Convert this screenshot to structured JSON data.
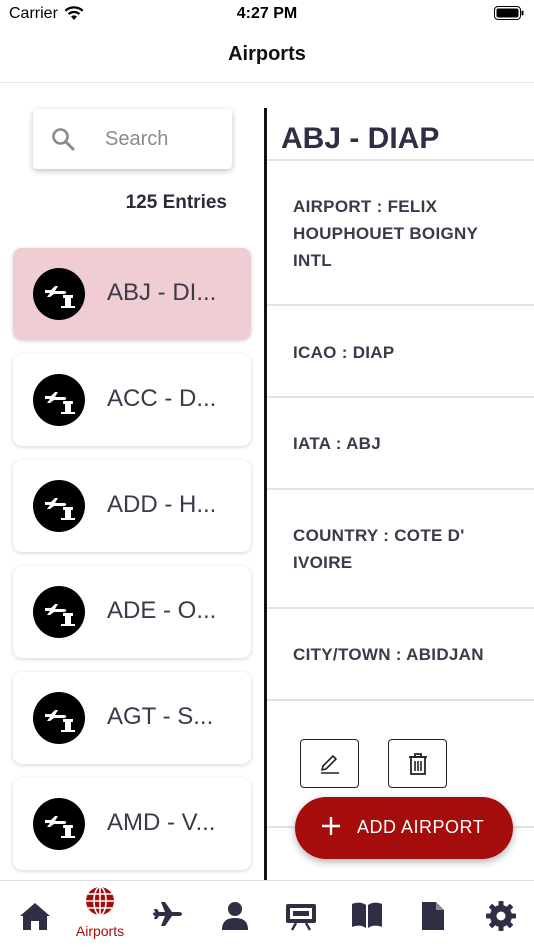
{
  "status_bar": {
    "carrier": "Carrier",
    "time": "4:27 PM"
  },
  "header": {
    "title": "Airports"
  },
  "search": {
    "placeholder": "Search"
  },
  "entries_count": "125 Entries",
  "airports": [
    {
      "label": "ABJ - DI...",
      "selected": true
    },
    {
      "label": "ACC - D..."
    },
    {
      "label": "ADD - H..."
    },
    {
      "label": "ADE - O..."
    },
    {
      "label": "AGT - S..."
    },
    {
      "label": "AMD - V..."
    }
  ],
  "detail": {
    "title": "ABJ - DIAP",
    "airport": "AIRPORT : FELIX HOUPHOUET BOIGNY INTL",
    "icao": "ICAO : DIAP",
    "iata": "IATA : ABJ",
    "country": "COUNTRY : COTE D' IVOIRE",
    "city": "CITY/TOWN : ABIDJAN"
  },
  "fab": {
    "label": "ADD  AIRPORT"
  },
  "tabbar": {
    "active_label": "Airports",
    "items": [
      "home-icon",
      "globe-icon",
      "airplane-icon",
      "user-icon",
      "presentation-icon",
      "book-icon",
      "document-icon",
      "gear-icon"
    ]
  },
  "colors": {
    "accent": "#a50d0d",
    "selected_row": "#efcdd2",
    "text_dark": "#2e2e44"
  }
}
